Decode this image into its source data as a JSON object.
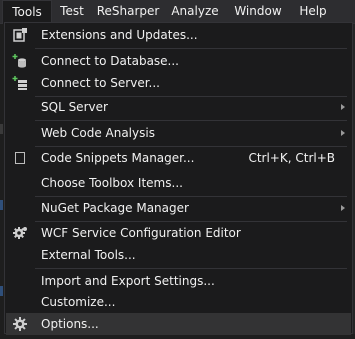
{
  "menubar": {
    "items": [
      {
        "label": "Tools"
      },
      {
        "label": "Test"
      },
      {
        "label": "ReSharper"
      },
      {
        "label": "Analyze"
      },
      {
        "label": "Window"
      },
      {
        "label": "Help"
      }
    ]
  },
  "dropdown": {
    "items": [
      {
        "label": "Extensions and Updates...",
        "icon": "extensions-icon"
      },
      {
        "label": "Connect to Database...",
        "icon": "database-connect-icon"
      },
      {
        "label": "Connect to Server...",
        "icon": "server-connect-icon"
      },
      {
        "label": "SQL Server",
        "submenu": true
      },
      {
        "label": "Web Code Analysis",
        "submenu": true
      },
      {
        "label": "Code Snippets Manager...",
        "shortcut": "Ctrl+K, Ctrl+B",
        "icon": "snippet-icon"
      },
      {
        "label": "Choose Toolbox Items..."
      },
      {
        "label": "NuGet Package Manager",
        "submenu": true
      },
      {
        "label": "WCF Service Configuration Editor",
        "icon": "gear-icon"
      },
      {
        "label": "External Tools..."
      },
      {
        "label": "Import and Export Settings..."
      },
      {
        "label": "Customize..."
      },
      {
        "label": "Options...",
        "icon": "gear-icon"
      }
    ]
  },
  "colors": {
    "menu_background": "#1b1b1c",
    "menubar_background": "#2d2d30",
    "highlight": "#333334",
    "separator": "#333337",
    "text": "#f1f1f1",
    "connect_icon_accent": "#5ec85e"
  }
}
